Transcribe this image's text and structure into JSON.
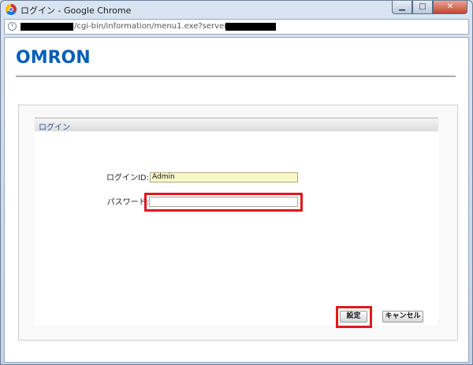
{
  "window": {
    "title": "ログイン - Google Chrome",
    "controls": {
      "minimize": "▁",
      "maximize": "□",
      "close": "✕"
    }
  },
  "address_bar": {
    "url_visible": "/cgi-bin/information/menu1.exe?serverip="
  },
  "brand": {
    "logo_text": "OMRON",
    "color": "#005eb8"
  },
  "login_panel": {
    "title": "ログイン",
    "fields": [
      {
        "label": "ログインID:",
        "value": "Admin"
      },
      {
        "label": "パスワード:",
        "value": ""
      }
    ],
    "buttons": {
      "submit": "設定",
      "cancel": "キャンセル"
    }
  },
  "colors": {
    "highlight": "#e0171d",
    "input_bg": "#fbf8c8"
  }
}
